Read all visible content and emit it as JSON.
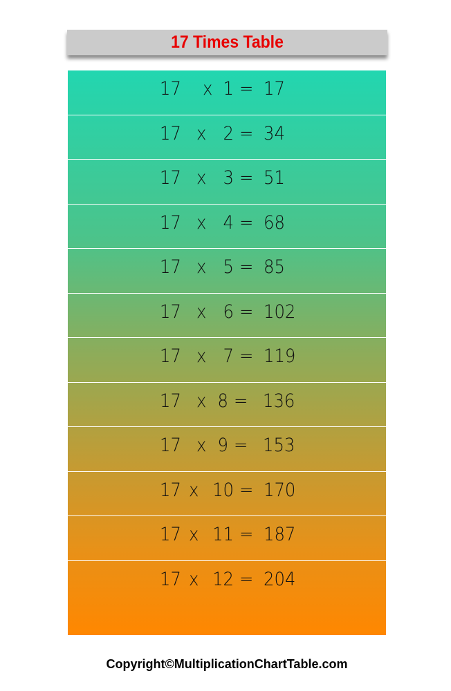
{
  "title": "17 Times Table",
  "colors": {
    "title_text": "#e80000",
    "title_bar": "#cbcbcb",
    "gradient_top": "#22d6b0",
    "gradient_bottom": "#ff8700",
    "separator": "#ffffff"
  },
  "rows": [
    {
      "a": "17",
      "op": "x",
      "b": "1",
      "eq": "=",
      "result": "17"
    },
    {
      "a": "17",
      "op": "x",
      "b": "2",
      "eq": "=",
      "result": "34"
    },
    {
      "a": "17",
      "op": "x",
      "b": "3",
      "eq": "=",
      "result": "51"
    },
    {
      "a": "17",
      "op": "x",
      "b": "4",
      "eq": "=",
      "result": "68"
    },
    {
      "a": "17",
      "op": "x",
      "b": "5",
      "eq": "=",
      "result": "85"
    },
    {
      "a": "17",
      "op": "x",
      "b": "6",
      "eq": "=",
      "result": "102"
    },
    {
      "a": "17",
      "op": "x",
      "b": "7",
      "eq": "=",
      "result": "119"
    },
    {
      "a": "17",
      "op": "x",
      "b": "8",
      "eq": "=",
      "result": "136"
    },
    {
      "a": "17",
      "op": "x",
      "b": "9",
      "eq": "=",
      "result": "153"
    },
    {
      "a": "17",
      "op": "x",
      "b": "10",
      "eq": "=",
      "result": "170"
    },
    {
      "a": "17",
      "op": "x",
      "b": "11",
      "eq": "=",
      "result": "187"
    },
    {
      "a": "17",
      "op": "x",
      "b": "12",
      "eq": "=",
      "result": "204"
    }
  ],
  "footer": "Copyright©MultiplicationChartTable.com"
}
